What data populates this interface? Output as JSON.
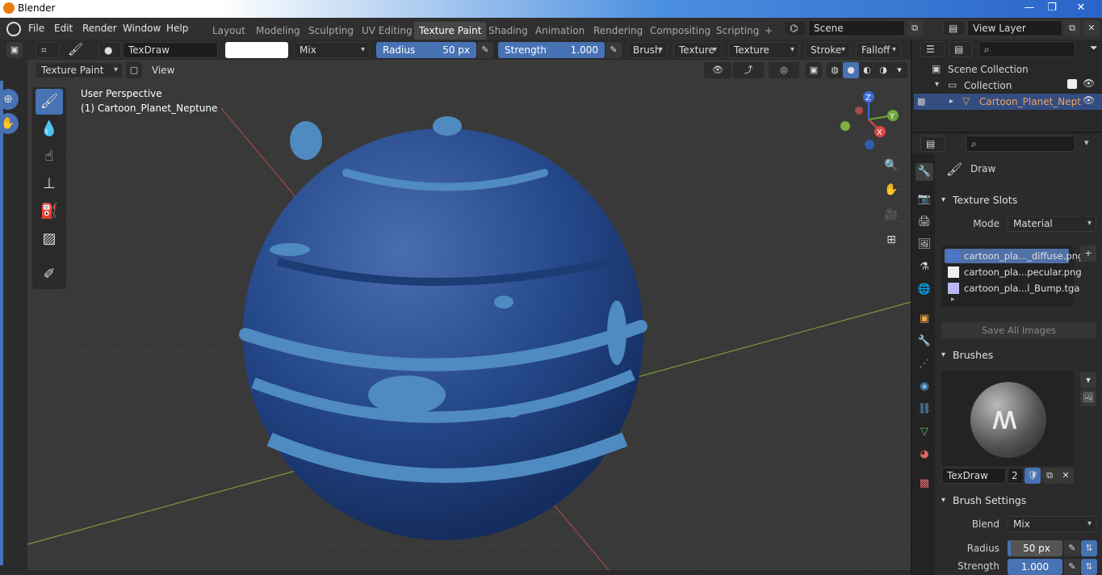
{
  "window": {
    "title": "Blender",
    "controls": [
      "—",
      "❐",
      "✕"
    ]
  },
  "menubar": {
    "items": [
      "File",
      "Edit",
      "Render",
      "Window",
      "Help"
    ],
    "workspaces": [
      "Layout",
      "Modeling",
      "Sculpting",
      "UV Editing",
      "Texture Paint",
      "Shading",
      "Animation",
      "Rendering",
      "Compositing",
      "Scripting",
      "+"
    ],
    "active_workspace": "Texture Paint",
    "scene": "Scene",
    "view_layer": "View Layer"
  },
  "toolheader": {
    "brush_name": "TexDraw",
    "blend": "Mix",
    "radius_label": "Radius",
    "radius_value": "50 px",
    "strength_label": "Strength",
    "strength_value": "1.000",
    "menus": [
      "Brush",
      "Texture",
      "Texture Mask",
      "Stroke",
      "Falloff"
    ]
  },
  "viewheader": {
    "mode": "Texture Paint",
    "view": "View"
  },
  "viewport": {
    "perspective": "User Perspective",
    "object": "(1) Cartoon_Planet_Neptune",
    "gizmo_axes": {
      "z": "Z",
      "y": "Y",
      "x": "X"
    }
  },
  "outliner": {
    "root": "Scene Collection",
    "collection": "Collection",
    "object": "Cartoon_Planet_Nept"
  },
  "properties": {
    "tool_name": "Draw",
    "texture_slots": {
      "title": "Texture Slots",
      "mode_label": "Mode",
      "mode_value": "Material",
      "slots": [
        {
          "name": "cartoon_pla..._diffuse.png",
          "color": "#4a78c8",
          "selected": true
        },
        {
          "name": "cartoon_pla...pecular.png",
          "color": "#eeeeee",
          "selected": false
        },
        {
          "name": "cartoon_pla...l_Bump.tga",
          "color": "#b9b9f5",
          "selected": false
        }
      ],
      "save_all": "Save All Images"
    },
    "brushes": {
      "title": "Brushes",
      "brush_name": "TexDraw",
      "users": "2"
    },
    "brush_settings": {
      "title": "Brush Settings",
      "blend_label": "Blend",
      "blend_value": "Mix",
      "radius_label": "Radius",
      "radius_value": "50 px",
      "strength_label": "Strength",
      "strength_value": "1.000"
    }
  },
  "colors": {
    "accent": "#4772b3",
    "planet": "#2a4d8f",
    "planet_highlight": "#4d86b8",
    "background": "#393939"
  }
}
